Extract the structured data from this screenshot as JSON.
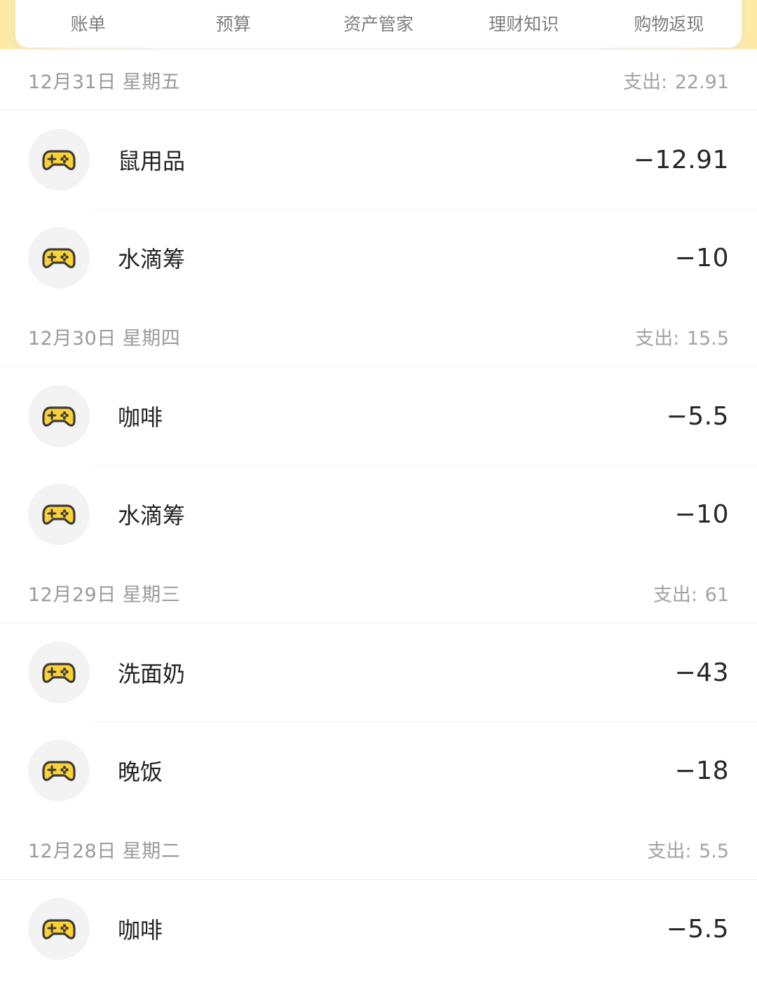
{
  "nav": {
    "tabs": [
      {
        "label": "账单"
      },
      {
        "label": "预算"
      },
      {
        "label": "资产管家"
      },
      {
        "label": "理财知识"
      },
      {
        "label": "购物返现"
      }
    ]
  },
  "category_icon": "gamepad-icon",
  "colors": {
    "icon_fill": "#FFD233",
    "icon_stroke": "#3B3B3B",
    "accent_glow": "#FDE9A4"
  },
  "groups": [
    {
      "date": "12月31日 星期五",
      "total_label": "支出:",
      "total_value": "22.91",
      "entries": [
        {
          "name": "鼠用品",
          "amount": "−12.91"
        },
        {
          "name": "水滴筹",
          "amount": "−10"
        }
      ]
    },
    {
      "date": "12月30日 星期四",
      "total_label": "支出:",
      "total_value": "15.5",
      "entries": [
        {
          "name": "咖啡",
          "amount": "−5.5"
        },
        {
          "name": "水滴筹",
          "amount": "−10"
        }
      ]
    },
    {
      "date": "12月29日 星期三",
      "total_label": "支出:",
      "total_value": "61",
      "entries": [
        {
          "name": "洗面奶",
          "amount": "−43"
        },
        {
          "name": "晚饭",
          "amount": "−18"
        }
      ]
    },
    {
      "date": "12月28日 星期二",
      "total_label": "支出:",
      "total_value": "5.5",
      "entries": [
        {
          "name": "咖啡",
          "amount": "−5.5"
        }
      ]
    }
  ]
}
